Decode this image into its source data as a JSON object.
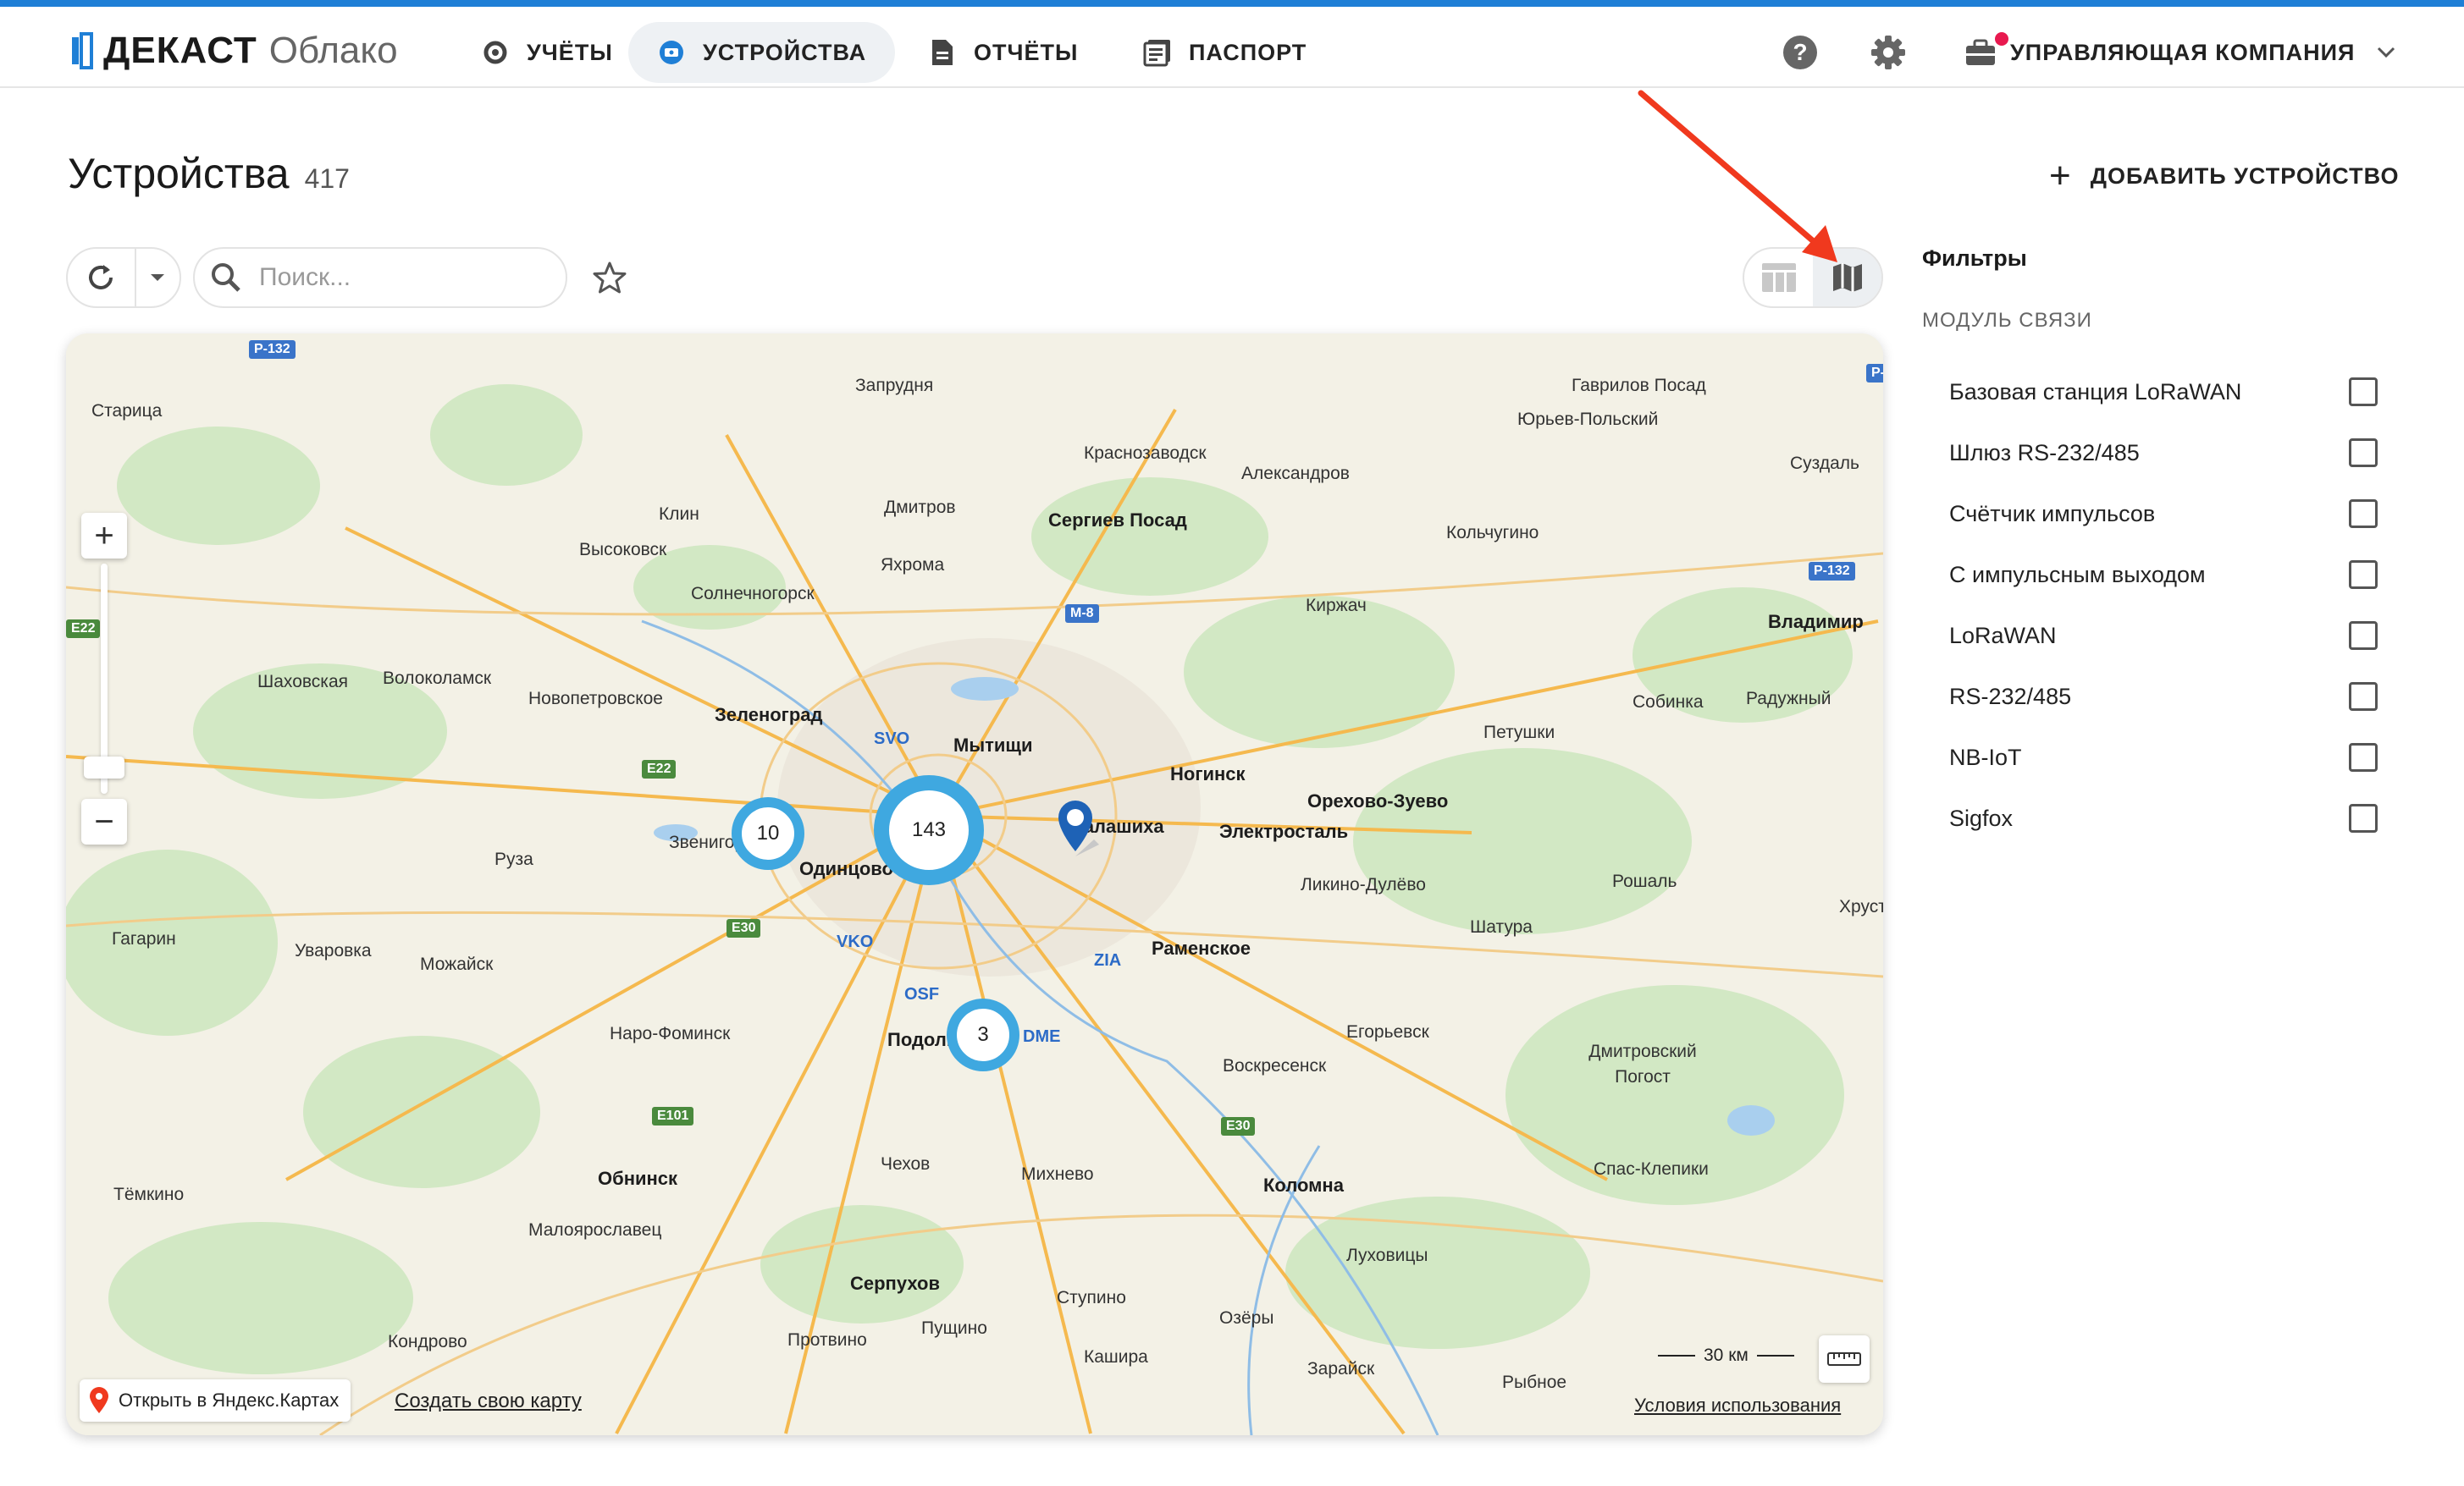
{
  "brand": {
    "name": "ДЕКАСТ",
    "product": "Облако"
  },
  "nav": [
    {
      "id": "accounts",
      "label": "УЧЁТЫ",
      "active": false
    },
    {
      "id": "devices",
      "label": "УСТРОЙСТВА",
      "active": true
    },
    {
      "id": "reports",
      "label": "ОТЧЁТЫ",
      "active": false
    },
    {
      "id": "passport",
      "label": "ПАСПОРТ",
      "active": false
    }
  ],
  "header": {
    "company": "УПРАВЛЯЮЩАЯ КОМПАНИЯ"
  },
  "page": {
    "title": "Устройства",
    "count": "417",
    "add_button": "ДОБАВИТЬ УСТРОЙСТВО"
  },
  "toolbar": {
    "search_placeholder": "Поиск...",
    "view_mode": "map"
  },
  "map": {
    "clusters": [
      {
        "id": "cluster-10",
        "count": "10"
      },
      {
        "id": "cluster-143",
        "count": "143"
      },
      {
        "id": "cluster-3",
        "count": "3"
      }
    ],
    "towns": [
      "Запрудня",
      "Гаврилов Посад",
      "Юрьев-Польский",
      "Старица",
      "Краснозаводск",
      "Александров",
      "Суздаль",
      "Дмитров",
      "Сергиев Посад",
      "Клин",
      "Высоковск",
      "Яхрома",
      "Кольчугино",
      "Солнечногорск",
      "Киржач",
      "Владимир",
      "Шаховская",
      "Волоколамск",
      "Новопетровское",
      "Зеленоград",
      "Мытищи",
      "Собинка",
      "Радужный",
      "Петушки",
      "Ногинск",
      "Орехово-Зуево",
      "Электросталь",
      "Руза",
      "Звенигород",
      "Одинцово",
      "Балашиха",
      "Ликино-Дулёво",
      "Рошаль",
      "Хрусталь",
      "Гагарин",
      "Уваровка",
      "Можайск",
      "Раменское",
      "Шатура",
      "Наро-Фоминск",
      "Подольск",
      "Егорьевск",
      "Дмитровский Погост",
      "Воскресенск",
      "Обнинск",
      "Чехов",
      "Михнево",
      "Коломна",
      "Спас-Клепики",
      "Тёмкино",
      "Малоярославец",
      "Луховицы",
      "Серпухов",
      "Ступино",
      "Озёры",
      "Кондрово",
      "Протвино",
      "Пущино",
      "Кашира",
      "Зарайск",
      "Рыбное"
    ],
    "airports": [
      "SVO",
      "VKO",
      "OSF",
      "DME",
      "ZIA"
    ],
    "roads": [
      "Р-132",
      "М-8",
      "Е22",
      "Е30",
      "Е101"
    ],
    "scale": "30 км",
    "open_in_yandex": "Открыть в Яндекс.Картах",
    "create_map": "Создать свою карту",
    "terms": "Условия использования"
  },
  "filters": {
    "title": "Фильтры",
    "group": "МОДУЛЬ СВЯЗИ",
    "items": [
      {
        "label": "Базовая станция LoRaWAN",
        "checked": false
      },
      {
        "label": "Шлюз RS-232/485",
        "checked": false
      },
      {
        "label": "Счётчик импульсов",
        "checked": false
      },
      {
        "label": "С импульсным выходом",
        "checked": false
      },
      {
        "label": "LoRaWAN",
        "checked": false
      },
      {
        "label": "RS-232/485",
        "checked": false
      },
      {
        "label": "NB-IoT",
        "checked": false
      },
      {
        "label": "Sigfox",
        "checked": false
      }
    ]
  },
  "colors": {
    "accent": "#1f7fd6",
    "cluster": "#3fa8e0",
    "annotation_arrow": "#f0391e",
    "notification_dot": "#e8194f"
  }
}
